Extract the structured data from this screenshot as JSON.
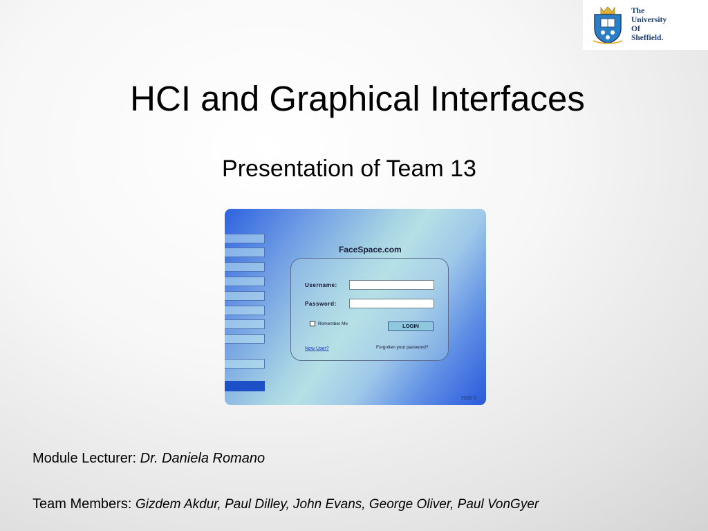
{
  "logo": {
    "line1": "The",
    "line2": "University",
    "line3": "Of",
    "line4": "Sheffield.",
    "crest_icon": "university-crest-icon",
    "colors": {
      "navy": "#1f3e6d",
      "shield_blue": "#2c7fc4",
      "gold": "#e2b43a"
    }
  },
  "slide": {
    "title": "HCI and Graphical Interfaces",
    "subtitle": "Presentation of Team 13"
  },
  "screenshot": {
    "site_title": "FaceSpace.com",
    "username_label": "Username:",
    "password_label": "Password:",
    "remember_label": "Remember Me",
    "login_button": "LOGIN",
    "new_user_link": "New User?",
    "forgot_link": "Forgotten your password?",
    "copyright": "2009 ©",
    "colors": {
      "gradient_blue": "#2e62e0",
      "gradient_light": "#b5e0e6",
      "button": "#8fc7df"
    }
  },
  "credits": {
    "lecturer_label": "Module Lecturer:",
    "lecturer_name": "Dr. Daniela Romano",
    "team_label": "Team Members:",
    "team_names": "Gizdem Akdur, Paul Dilley, John Evans, George Oliver, Paul VonGyer"
  }
}
